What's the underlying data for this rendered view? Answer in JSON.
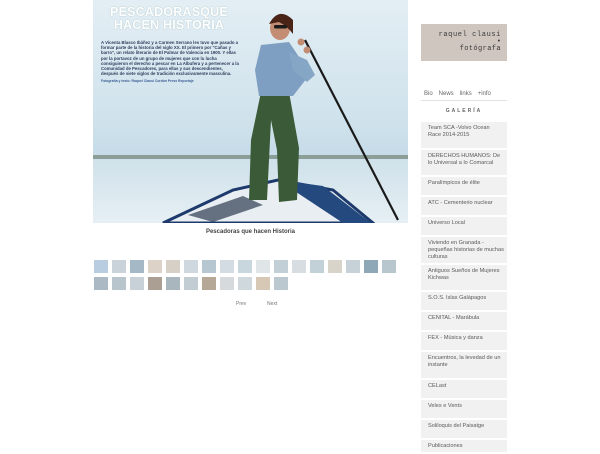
{
  "hero": {
    "title_line1": "PESCADORASQUE",
    "title_line2": "HACEN HISTORIA",
    "body": "A Vicenta Blasco Ibáñez y a Carmen Serrano les tuvo que pasado a formar parte de la historia del siglo XX. El primero por \"Cañas y barro\", un relato literario de El Palmar de Valencia en 1900. Y ellas por la portavoz de un grupo de mujeres que con lu lucha consiguieron el derecho a pescar en La Albufera y a pertenecer a la Comunidad de Pescadores, para ellas y sus descendientes, después de siete siglos de tradición exclusivamente masculina.",
    "credit": "Fotografía y texto: Raquel Clausí Cordón Press Reportaje"
  },
  "caption": "Pescadoras que hacen Historia",
  "pager": {
    "prev": "Prev",
    "next": "Next"
  },
  "thumbnails": [
    {
      "color": "#b9cde0"
    },
    {
      "color": "#c9d3d9"
    },
    {
      "color": "#a5b8c6"
    },
    {
      "color": "#ddd2c7"
    },
    {
      "color": "#d6d0c6"
    },
    {
      "color": "#cfd8df"
    },
    {
      "color": "#b7c7d2"
    },
    {
      "color": "#d2dce2"
    },
    {
      "color": "#c8d6dd"
    },
    {
      "color": "#e0e6e8"
    },
    {
      "color": "#c3cfd6"
    },
    {
      "color": "#d7dde1"
    },
    {
      "color": "#c2d0d8"
    },
    {
      "color": "#d9d4ca"
    },
    {
      "color": "#c6d2d8"
    },
    {
      "color": "#8ea8b8"
    },
    {
      "color": "#b8c6ce"
    },
    {
      "color": "#aab9c3"
    },
    {
      "color": "#b9c5cd"
    },
    {
      "color": "#c7d1d7"
    },
    {
      "color": "#ab9f94"
    },
    {
      "color": "#a9b6be"
    },
    {
      "color": "#c2cdd3"
    },
    {
      "color": "#b6a897"
    },
    {
      "color": "#d6dadc"
    },
    {
      "color": "#cfd8dc"
    },
    {
      "color": "#d6c8b5"
    },
    {
      "color": "#bcc8cf"
    }
  ],
  "logo": {
    "line1": "raquel clausí",
    "line2": "•",
    "line3": "fotógrafa"
  },
  "topnav": [
    "Bio",
    "News",
    "links",
    "+info"
  ],
  "gallery_title": "GALERÍA",
  "menu": [
    {
      "label": "Team SCA -Volvo Ocean Race 2014-2015",
      "size": "h2"
    },
    {
      "label": "DERECHOS HUMANOS: De lo Universal a lo Comarcal",
      "size": "h2"
    },
    {
      "label": "Paralímpicos de élite",
      "size": "h1"
    },
    {
      "label": "ATC - Cementerio nuclear",
      "size": "h1"
    },
    {
      "label": "Universo Local",
      "size": "h1"
    },
    {
      "label": "Viviendo en Granada - pequeñas historias de muchas culturas",
      "size": "h2"
    },
    {
      "label": "Antiguos Sueños de Mujeres Kichwas",
      "size": "h2"
    },
    {
      "label": "S.O.S. Islas Galápagos",
      "size": "h1"
    },
    {
      "label": "CENITAL - Marábula",
      "size": "h1"
    },
    {
      "label": "FEX - Música y danza",
      "size": "h1"
    },
    {
      "label": "Encuentros, la levedad de un instante",
      "size": "h2"
    },
    {
      "label": "CELast",
      "size": "h1"
    },
    {
      "label": "Veles e Vents",
      "size": "h1"
    },
    {
      "label": "Soliloquis del Paisatge",
      "size": "h1"
    },
    {
      "label": "Publicaciones",
      "size": "cut"
    }
  ]
}
